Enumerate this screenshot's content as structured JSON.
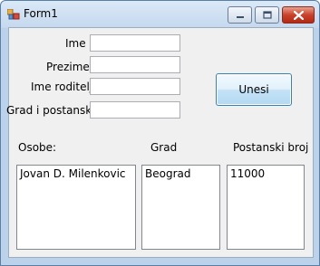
{
  "window": {
    "title": "Form1"
  },
  "icons": {
    "app": "form-app-icon",
    "minimize": "minimize-icon",
    "maximize": "maximize-icon",
    "close": "close-icon"
  },
  "form": {
    "ime_label": "Ime",
    "prezime_label": "Prezime",
    "ime_roditelja_label": "Ime roditelja",
    "grad_label": "Grad i postanski br.",
    "ime_value": "",
    "prezime_value": "",
    "ime_roditelja_value": "",
    "grad_value": "",
    "submit_label": "Unesi"
  },
  "lists": {
    "osobe_header": "Osobe:",
    "grad_header": "Grad",
    "postanski_header": "Postanski broj",
    "osobe_items": [
      "Jovan D. Milenkovic"
    ],
    "grad_items": [
      "Beograd"
    ],
    "postanski_items": [
      "11000"
    ]
  }
}
